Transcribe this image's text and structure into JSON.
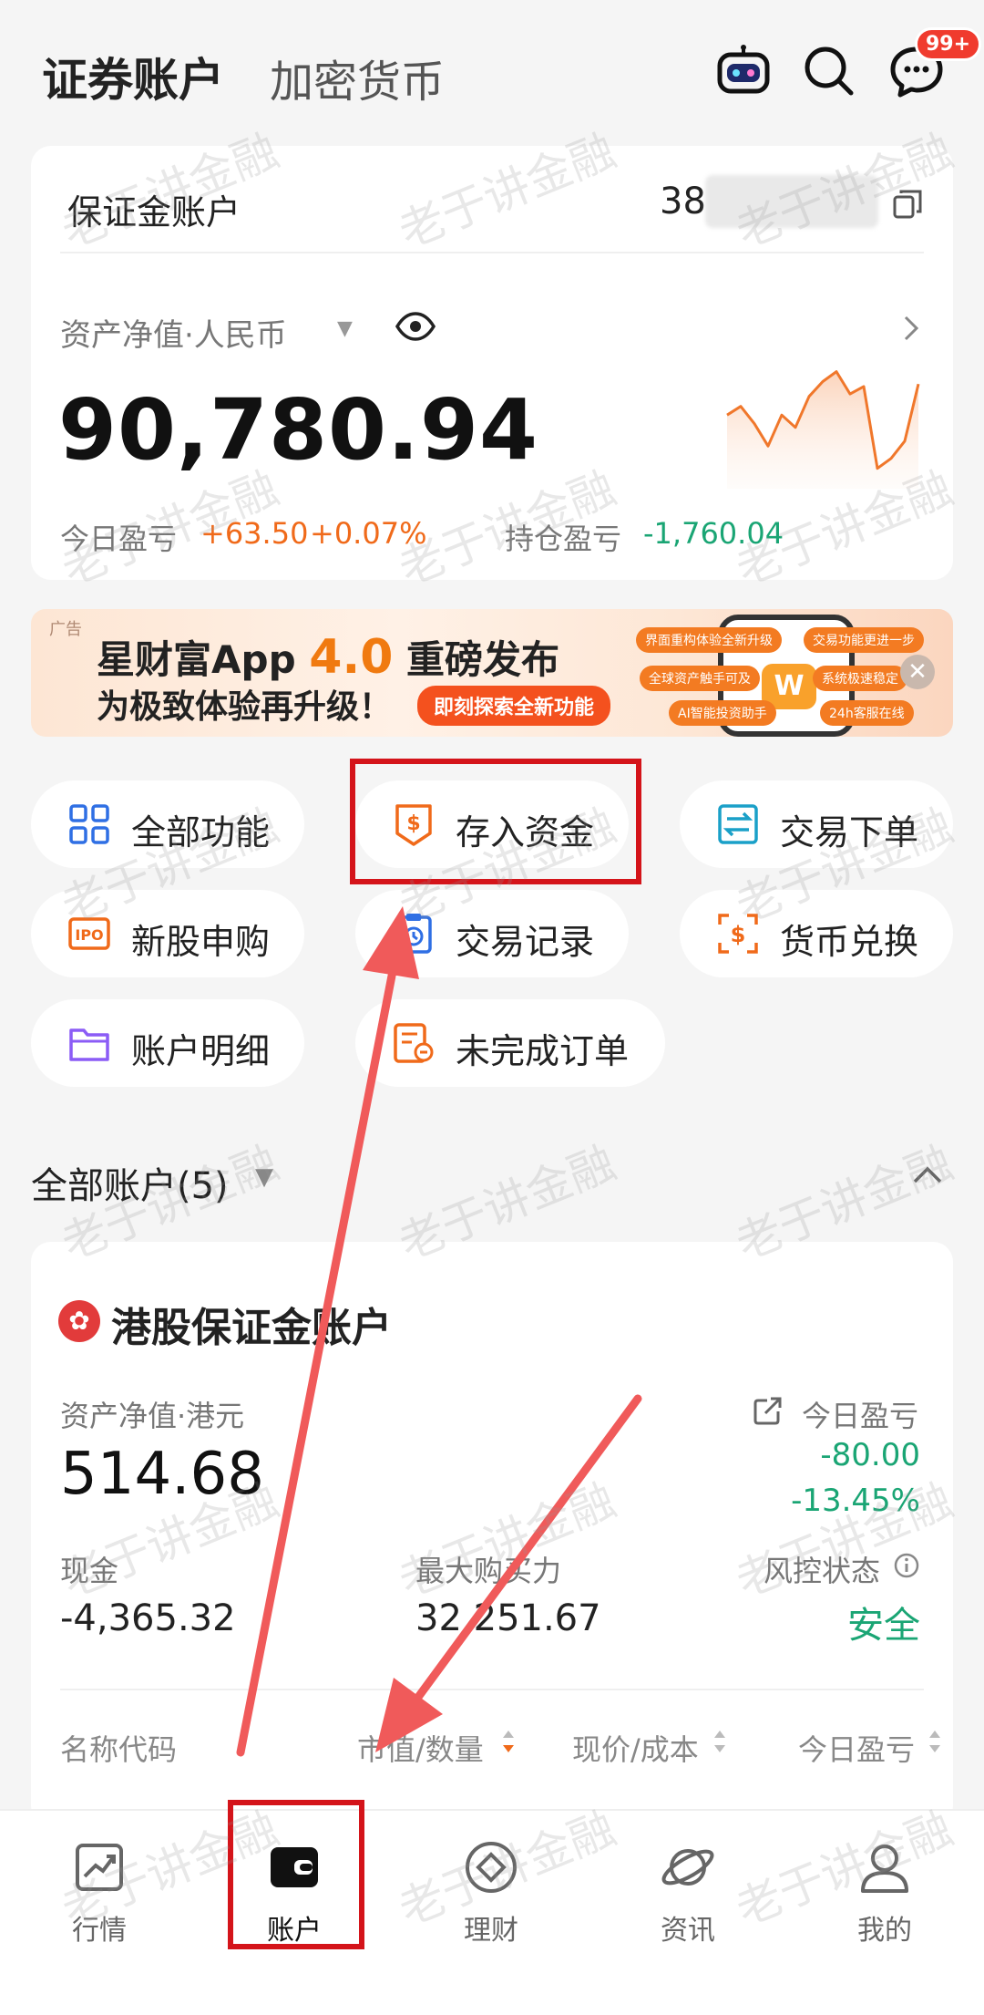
{
  "header": {
    "tab_active": "证券账户",
    "tab_other": "加密货币",
    "message_badge": "99+",
    "icons": [
      "robot-icon",
      "search-icon",
      "message-icon"
    ]
  },
  "margin_account": {
    "title": "保证金账户",
    "account_number_visible": "38",
    "net_asset_label": "资产净值·人民币",
    "net_asset_value": "90,780.94",
    "today_pl_label": "今日盈亏",
    "today_pl_value": "+63.50",
    "today_pl_percent": "+0.07%",
    "position_pl_label": "持仓盈亏",
    "position_pl_value": "-1,760.04"
  },
  "ad": {
    "tag": "广告",
    "line1_prefix": "星财富App ",
    "line1_highlight": "4.0",
    "line1_suffix": " 重磅发布",
    "line2": "为极致体验再升级！",
    "button": "即刻探索全新功能",
    "pills": [
      "界面重构体验全新升级",
      "交易功能更进一步",
      "全球资产触手可及",
      "系统极速稳定",
      "AI智能投资助手",
      "24h客服在线"
    ],
    "logo": "W",
    "close": "✕"
  },
  "functions": [
    {
      "label": "全部功能",
      "icon": "grid-icon"
    },
    {
      "label": "存入资金",
      "icon": "deposit-icon"
    },
    {
      "label": "交易下单",
      "icon": "trade-icon"
    },
    {
      "label": "新股申购",
      "icon": "ipo-icon"
    },
    {
      "label": "交易记录",
      "icon": "record-icon"
    },
    {
      "label": "货币兑换",
      "icon": "exchange-icon"
    },
    {
      "label": "账户明细",
      "icon": "folder-icon"
    },
    {
      "label": "未完成订单",
      "icon": "pending-order-icon"
    }
  ],
  "accounts_section": {
    "title": "全部账户(5)"
  },
  "hk_account": {
    "title": "港股保证金账户",
    "net_asset_label": "资产净值·港元",
    "net_asset_value": "514.68",
    "today_pl_label": "今日盈亏",
    "today_pl_value": "-80.00",
    "today_pl_percent": "-13.45%",
    "cash_label": "现金",
    "cash_value": "-4,365.32",
    "buying_power_label": "最大购买力",
    "buying_power_value": "32,251.67",
    "risk_label": "风控状态",
    "risk_value": "安全",
    "table_headers": [
      "名称代码",
      "市值/数量",
      "现价/成本",
      "今日盈亏"
    ]
  },
  "bottom_nav": [
    {
      "label": "行情",
      "icon": "chart-icon"
    },
    {
      "label": "账户",
      "icon": "wallet-icon"
    },
    {
      "label": "理财",
      "icon": "diamond-icon"
    },
    {
      "label": "资讯",
      "icon": "planet-icon"
    },
    {
      "label": "我的",
      "icon": "person-icon"
    }
  ],
  "watermark": "老于讲金融",
  "colors": {
    "gain": "#f06a1a",
    "loss": "#1aa574",
    "annotation_red": "#d4141a",
    "arrow_red": "#f05a5a"
  },
  "sparkline": [
    0.55,
    0.62,
    0.48,
    0.3,
    0.55,
    0.45,
    0.7,
    0.82,
    0.9,
    0.72,
    0.78,
    0.12,
    0.2,
    0.34,
    0.8
  ]
}
